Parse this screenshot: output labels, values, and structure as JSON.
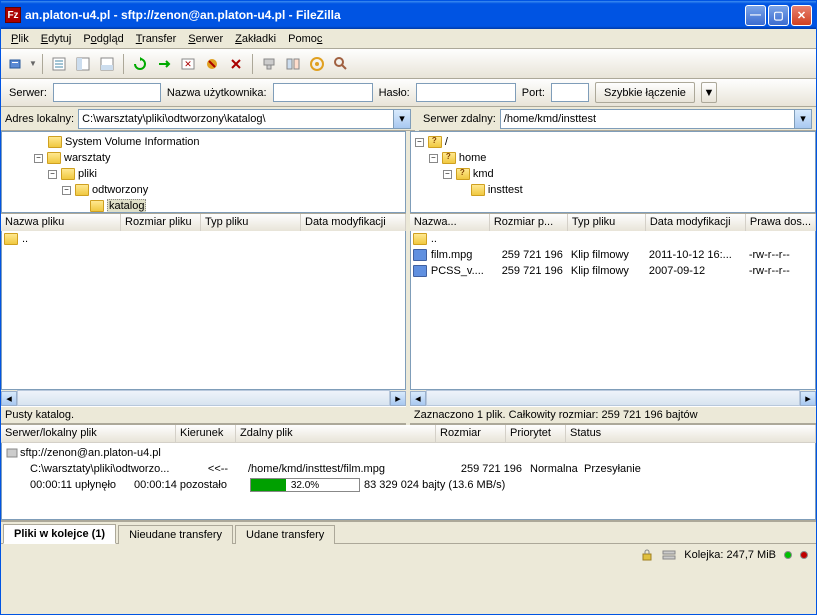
{
  "title": "an.platon-u4.pl - sftp://zenon@an.platon-u4.pl - FileZilla",
  "menu": {
    "plik": "Plik",
    "edytuj": "Edytuj",
    "podglad": "Podgląd",
    "transfer": "Transfer",
    "serwer": "Serwer",
    "zakladki": "Zakładki",
    "pomoc": "Pomoc"
  },
  "qc": {
    "serwer": "Serwer:",
    "user": "Nazwa użytkownika:",
    "haslo": "Hasło:",
    "port": "Port:",
    "connect": "Szybkie łączenie"
  },
  "local": {
    "label": "Adres lokalny:",
    "path": "C:\\warsztaty\\pliki\\odtworzony\\katalog\\",
    "tree": [
      "System Volume Information",
      "warsztaty",
      "pliki",
      "odtworzony",
      "katalog"
    ],
    "cols": {
      "name": "Nazwa pliku",
      "size": "Rozmiar pliku",
      "type": "Typ pliku",
      "date": "Data modyfikacji"
    },
    "status": "Pusty katalog."
  },
  "remote": {
    "label": "Serwer zdalny:",
    "path": "/home/kmd/insttest",
    "tree": [
      "/",
      "home",
      "kmd",
      "insttest"
    ],
    "cols": {
      "name": "Nazwa...",
      "size": "Rozmiar p...",
      "type": "Typ pliku",
      "date": "Data modyfikacji",
      "perm": "Prawa dos..."
    },
    "files": [
      {
        "name": "film.mpg",
        "size": "259 721 196",
        "type": "Klip filmowy",
        "date": "2011-10-12 16:...",
        "perm": "-rw-r--r--"
      },
      {
        "name": "PCSS_v....",
        "size": "259 721 196",
        "type": "Klip filmowy",
        "date": "2007-09-12",
        "perm": "-rw-r--r--"
      }
    ],
    "status": "Zaznaczono 1 plik. Całkowity rozmiar: 259 721 196 bajtów"
  },
  "queue": {
    "cols": {
      "local": "Serwer/lokalny plik",
      "dir": "Kierunek",
      "remote": "Zdalny plik",
      "size": "Rozmiar",
      "prio": "Priorytet",
      "status": "Status"
    },
    "server": "sftp://zenon@an.platon-u4.pl",
    "localfile": "C:\\warsztaty\\pliki\\odtworzo...",
    "direction": "<<--",
    "remotefile": "/home/kmd/insttest/film.mpg",
    "size": "259 721 196",
    "prio": "Normalna",
    "transfer_status": "Przesyłanie",
    "elapsed": "00:00:11 upłynęło",
    "remaining": "00:00:14 pozostało",
    "progress_pct": "32.0%",
    "bytes": "83 329 024 bajty (13.6 MB/s)"
  },
  "tabs": {
    "queued": "Pliki w kolejce (1)",
    "failed": "Nieudane transfery",
    "ok": "Udane transfery"
  },
  "statusbar": {
    "queue": "Kolejka: 247,7 MiB"
  }
}
